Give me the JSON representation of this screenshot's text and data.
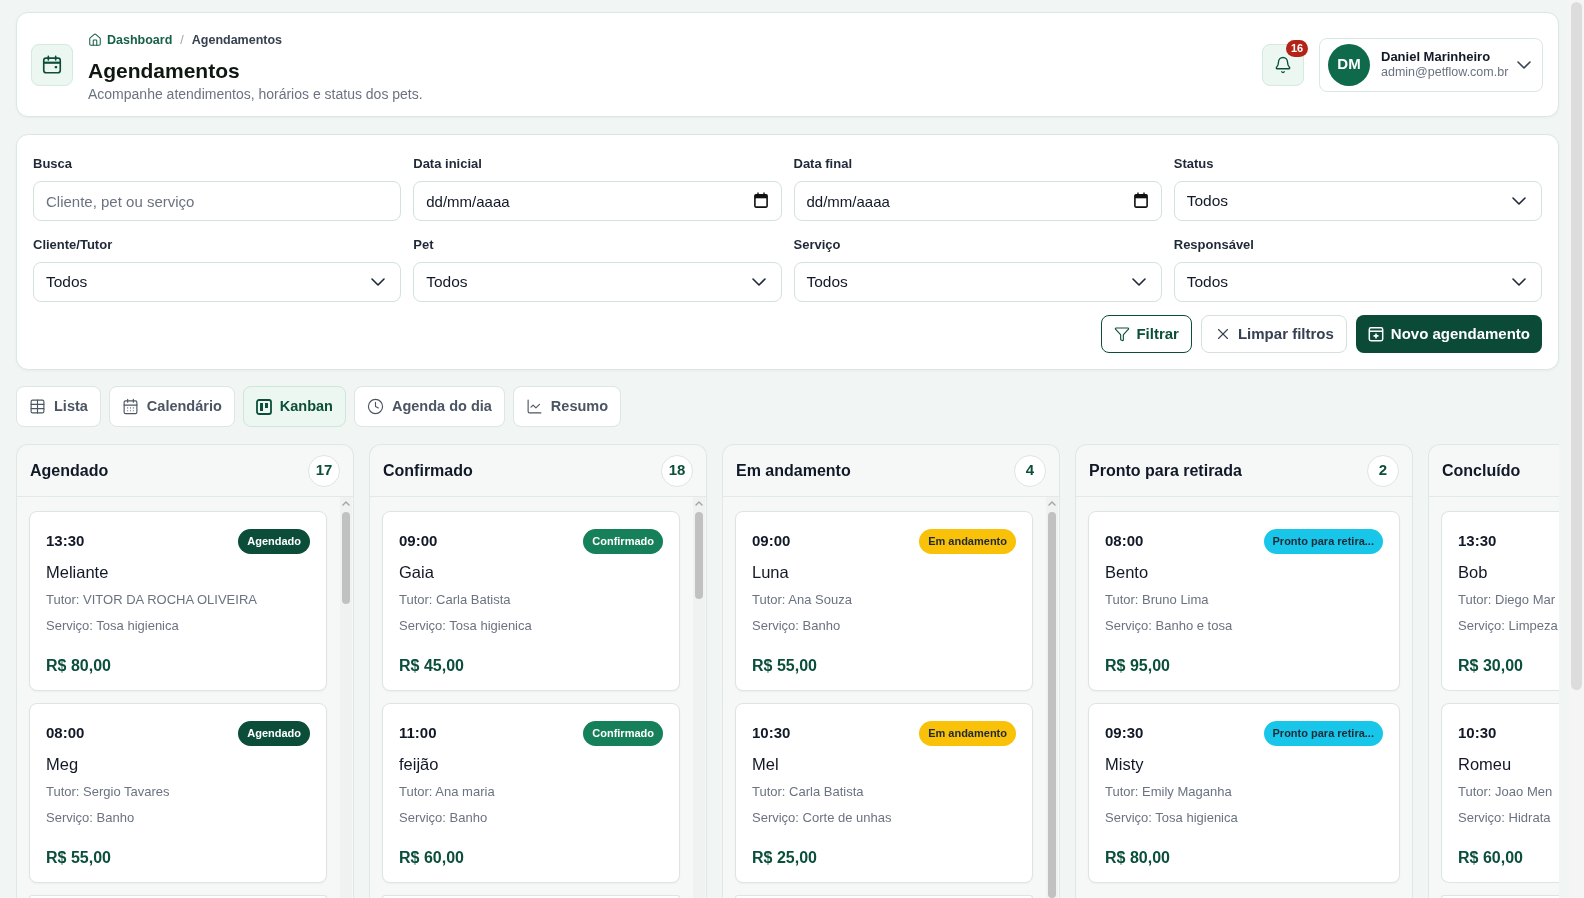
{
  "header": {
    "breadcrumb": [
      {
        "kind": "link",
        "label": "Dashboard"
      },
      {
        "kind": "current",
        "label": "Agendamentos"
      }
    ],
    "separator": "/",
    "title": "Agendamentos",
    "subtitle": "Acompanhe atendimentos, horários e status dos pets.",
    "notifications": {
      "count": "16"
    },
    "user": {
      "initials": "DM",
      "name": "Daniel Marinheiro",
      "email": "admin@petflow.com.br"
    }
  },
  "filters": {
    "fields": [
      {
        "kind": "text",
        "label": "Busca",
        "placeholder": "Cliente, pet ou serviço"
      },
      {
        "kind": "date",
        "label": "Data inicial",
        "placeholder": "dd/mm/aaaa"
      },
      {
        "kind": "date",
        "label": "Data final",
        "placeholder": "dd/mm/aaaa"
      },
      {
        "kind": "select",
        "label": "Status",
        "value": "Todos"
      },
      {
        "kind": "select",
        "label": "Cliente/Tutor",
        "value": "Todos"
      },
      {
        "kind": "select",
        "label": "Pet",
        "value": "Todos"
      },
      {
        "kind": "select",
        "label": "Serviço",
        "value": "Todos"
      },
      {
        "kind": "select",
        "label": "Responsável",
        "value": "Todos"
      }
    ],
    "buttons": [
      {
        "kind": "outline",
        "label": "Filtrar"
      },
      {
        "kind": "secondary",
        "label": "Limpar filtros"
      },
      {
        "kind": "primary",
        "label": "Novo agendamento"
      }
    ]
  },
  "view_tabs": [
    {
      "label": "Lista",
      "selected": false
    },
    {
      "label": "Calendário",
      "selected": false
    },
    {
      "label": "Kanban",
      "selected": true
    },
    {
      "label": "Agenda do dia",
      "selected": false
    },
    {
      "label": "Resumo",
      "selected": false
    }
  ],
  "kanban": {
    "columns": [
      {
        "title": "Agendado",
        "count": "17",
        "cards": [
          {
            "time": "13:30",
            "status": {
              "label": "Agendado",
              "color": "#0b4d38"
            },
            "pet": "Meliante",
            "tutor": "Tutor: VITOR DA ROCHA OLIVEIRA",
            "service": "Serviço: Tosa higienica",
            "price": "R$ 80,00"
          },
          {
            "time": "08:00",
            "status": {
              "label": "Agendado",
              "color": "#0b4d38"
            },
            "pet": "Meg",
            "tutor": "Tutor: Sergio Tavares",
            "service": "Serviço: Banho",
            "price": "R$ 55,00"
          }
        ]
      },
      {
        "title": "Confirmado",
        "count": "18",
        "cards": [
          {
            "time": "09:00",
            "status": {
              "label": "Confirmado",
              "color": "#16805a"
            },
            "pet": "Gaia",
            "tutor": "Tutor: Carla Batista",
            "service": "Serviço: Tosa higienica",
            "price": "R$ 45,00"
          },
          {
            "time": "11:00",
            "status": {
              "label": "Confirmado",
              "color": "#16805a"
            },
            "pet": "feijão",
            "tutor": "Tutor: Ana maria",
            "service": "Serviço: Banho",
            "price": "R$ 60,00"
          }
        ]
      },
      {
        "title": "Em andamento",
        "count": "4",
        "cards": [
          {
            "time": "09:00",
            "status": {
              "label": "Em andamento",
              "color": "#f9c108"
            },
            "pet": "Luna",
            "tutor": "Tutor: Ana Souza",
            "service": "Serviço: Banho",
            "price": "R$ 55,00"
          },
          {
            "time": "10:30",
            "status": {
              "label": "Em andamento",
              "color": "#f9c108"
            },
            "pet": "Mel",
            "tutor": "Tutor: Carla Batista",
            "service": "Serviço: Corte de unhas",
            "price": "R$ 25,00"
          }
        ]
      },
      {
        "title": "Pronto para retirada",
        "count": "2",
        "cards": [
          {
            "time": "08:00",
            "status": {
              "label": "Pronto para retira...",
              "color": "#18c6ea"
            },
            "pet": "Bento",
            "tutor": "Tutor: Bruno Lima",
            "service": "Serviço: Banho e tosa",
            "price": "R$ 95,00"
          },
          {
            "time": "09:30",
            "status": {
              "label": "Pronto para retira...",
              "color": "#18c6ea"
            },
            "pet": "Misty",
            "tutor": "Tutor: Emily Maganha",
            "service": "Serviço: Tosa higienica",
            "price": "R$ 80,00"
          }
        ]
      },
      {
        "title": "Concluído",
        "cards": [
          {
            "time": "13:30",
            "pet": "Bob",
            "tutor": "Tutor: Diego Mar",
            "service": "Serviço: Limpeza",
            "price": "R$ 30,00"
          },
          {
            "time": "10:30",
            "pet": "Romeu",
            "tutor": "Tutor: Joao Men",
            "service": "Serviço: Hidrata",
            "price": "R$ 60,00"
          }
        ]
      }
    ]
  }
}
